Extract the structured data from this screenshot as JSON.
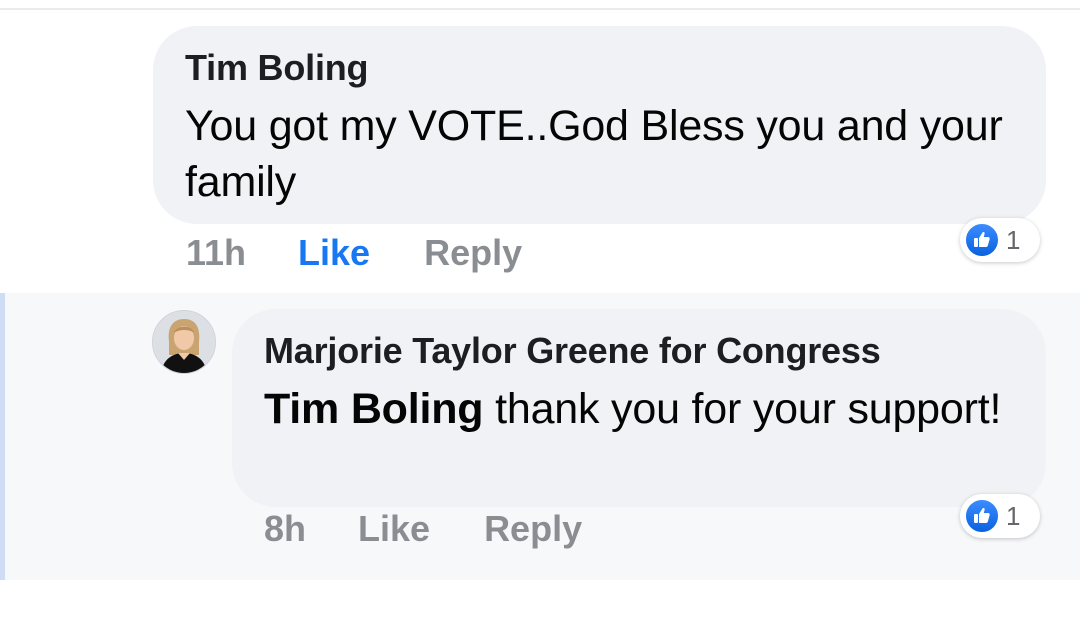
{
  "comment": {
    "author": "Tim Boling",
    "text": "You got my VOTE..God Bless you and your family",
    "time": "11h",
    "like_label": "Like",
    "reply_label": "Reply",
    "reaction_count": "1",
    "like_color": "#1877f2"
  },
  "reply": {
    "author": "Marjorie Taylor Greene for Congress",
    "mention": "Tim Boling",
    "text": " thank you for your support!",
    "time": "8h",
    "like_label": "Like",
    "reply_label": "Reply",
    "reaction_count": "1"
  }
}
